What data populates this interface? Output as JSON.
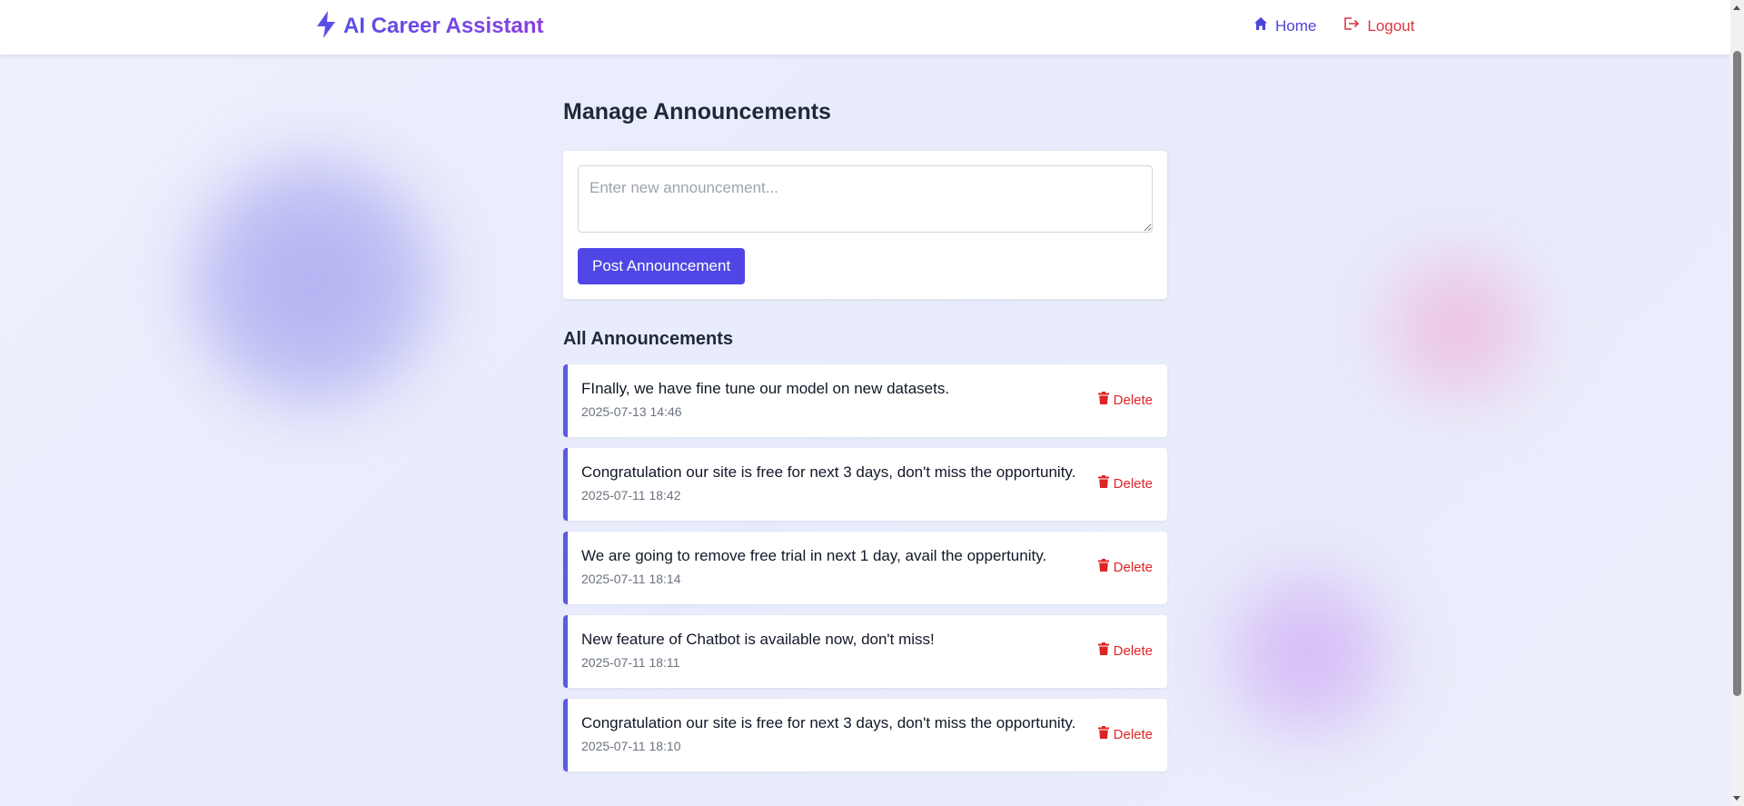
{
  "brand": {
    "name": "AI Career Assistant",
    "icon": "lightning-bolt-icon",
    "color": "#5a4ee8"
  },
  "nav": {
    "home_label": "Home",
    "home_icon": "home-icon",
    "logout_label": "Logout",
    "logout_icon": "logout-icon"
  },
  "page": {
    "title": "Manage Announcements"
  },
  "form": {
    "placeholder": "Enter new announcement...",
    "value": "",
    "submit_label": "Post Announcement"
  },
  "announcements": {
    "section_title": "All Announcements",
    "delete_label": "Delete",
    "items": [
      {
        "text": "FInally, we have fine tune our model on new datasets.",
        "timestamp": "2025-07-13 14:46"
      },
      {
        "text": "Congratulation our site is free for next 3 days, don't miss the opportunity.",
        "timestamp": "2025-07-11 18:42"
      },
      {
        "text": "We are going to remove free trial in next 1 day, avail the oppertunity.",
        "timestamp": "2025-07-11 18:14"
      },
      {
        "text": "New feature of Chatbot is available now, don't miss!",
        "timestamp": "2025-07-11 18:11"
      },
      {
        "text": "Congratulation our site is free for next 3 days, don't miss the opportunity.",
        "timestamp": "2025-07-11 18:10"
      }
    ]
  },
  "colors": {
    "accent": "#4f46e5",
    "danger": "#dc2626",
    "item_border": "#5b5bdf"
  }
}
